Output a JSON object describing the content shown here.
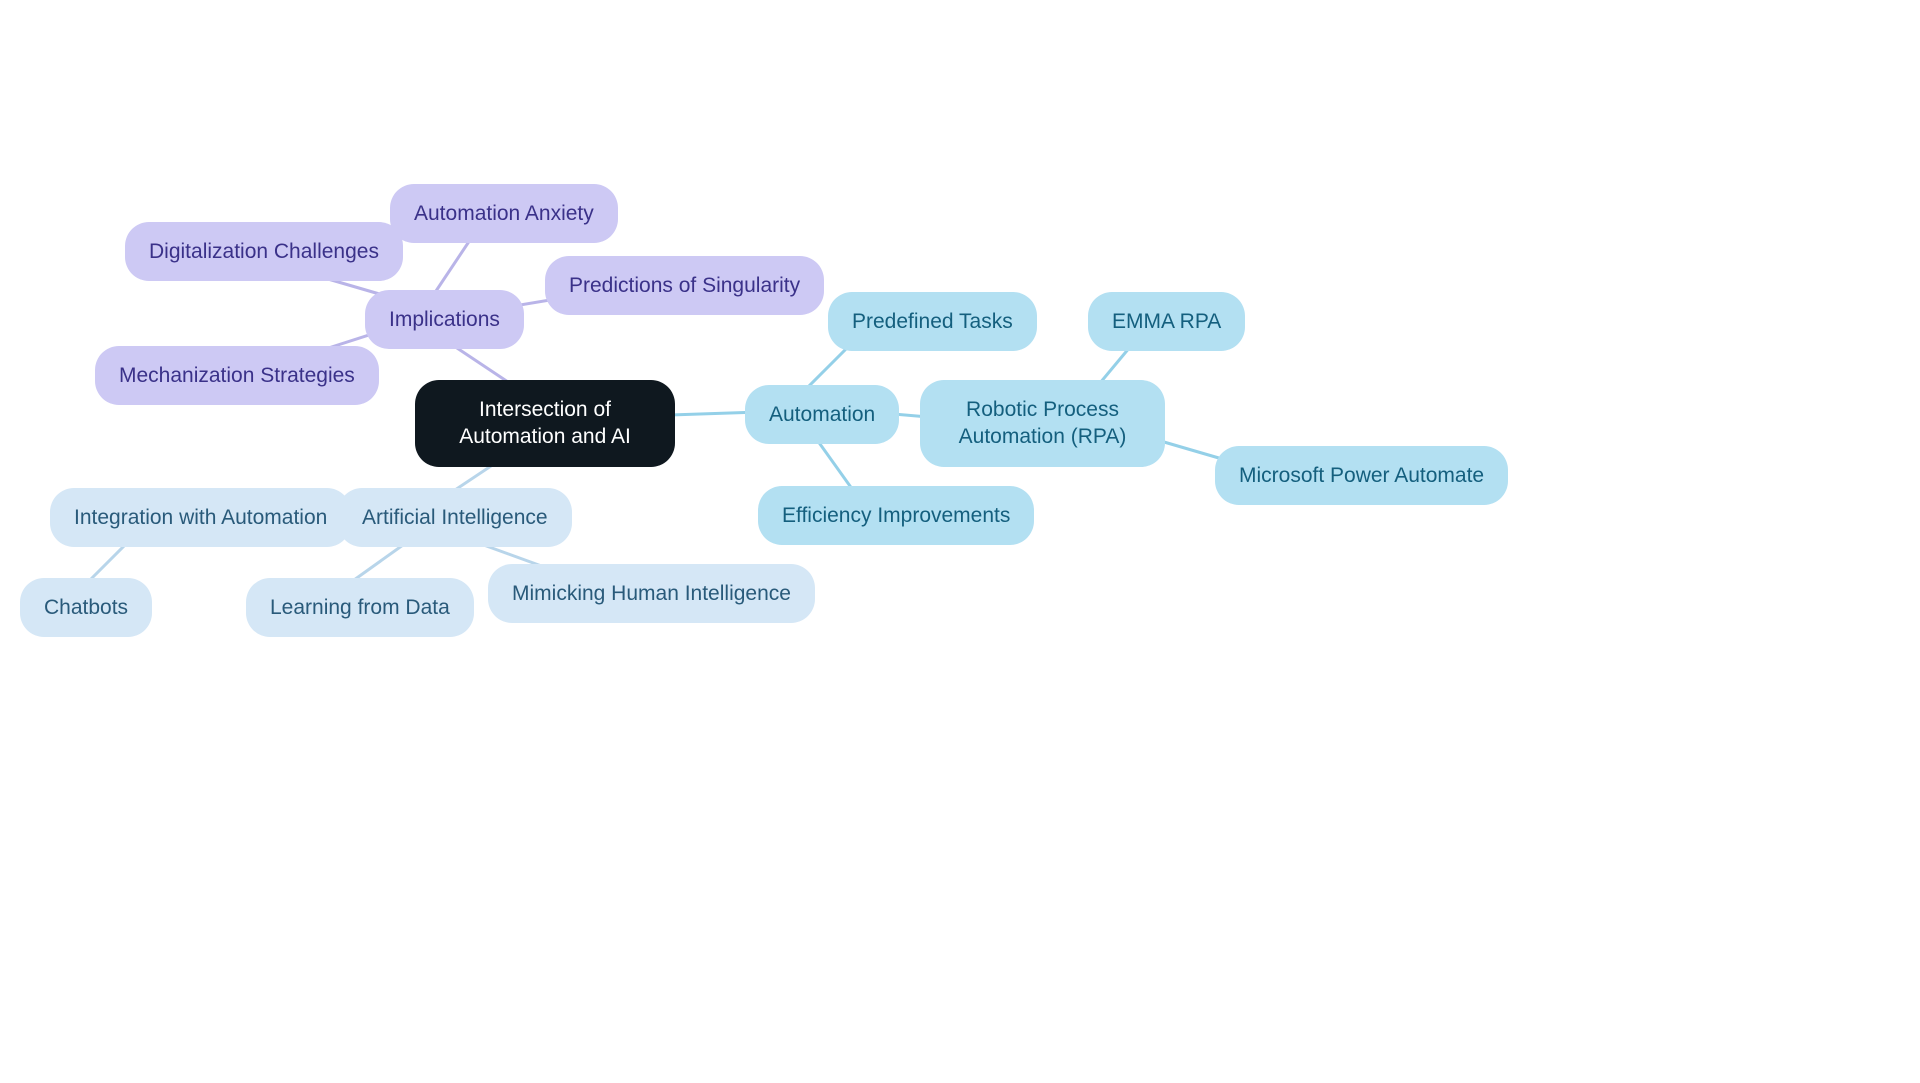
{
  "root": {
    "label": "Intersection of Automation and AI"
  },
  "implications": {
    "label": "Implications",
    "children": {
      "automation_anxiety": "Automation Anxiety",
      "digitalization_challenges": "Digitalization Challenges",
      "predictions_singularity": "Predictions of Singularity",
      "mechanization_strategies": "Mechanization Strategies"
    }
  },
  "automation": {
    "label": "Automation",
    "children": {
      "predefined_tasks": "Predefined Tasks",
      "efficiency_improvements": "Efficiency Improvements",
      "rpa": {
        "label": "Robotic Process Automation (RPA)",
        "children": {
          "emma_rpa": "EMMA RPA",
          "ms_power_automate": "Microsoft Power Automate"
        }
      }
    }
  },
  "ai": {
    "label": "Artificial Intelligence",
    "children": {
      "integration_automation": {
        "label": "Integration with Automation",
        "children": {
          "chatbots": "Chatbots"
        }
      },
      "learning_from_data": "Learning from Data",
      "mimicking_human": "Mimicking Human Intelligence"
    }
  },
  "colors": {
    "root_bg": "#0f181f",
    "root_text": "#ffffff",
    "purple_bg": "#cdc9f4",
    "purple_text": "#3a3189",
    "blue_bg": "#b3e0f2",
    "blue_text": "#145f7e",
    "lightblue_bg": "#d5e7f6",
    "lightblue_text": "#295a7a",
    "edge_purple": "#b9b4e8",
    "edge_blue": "#94d0e8",
    "edge_lightblue": "#b8d5ea"
  }
}
